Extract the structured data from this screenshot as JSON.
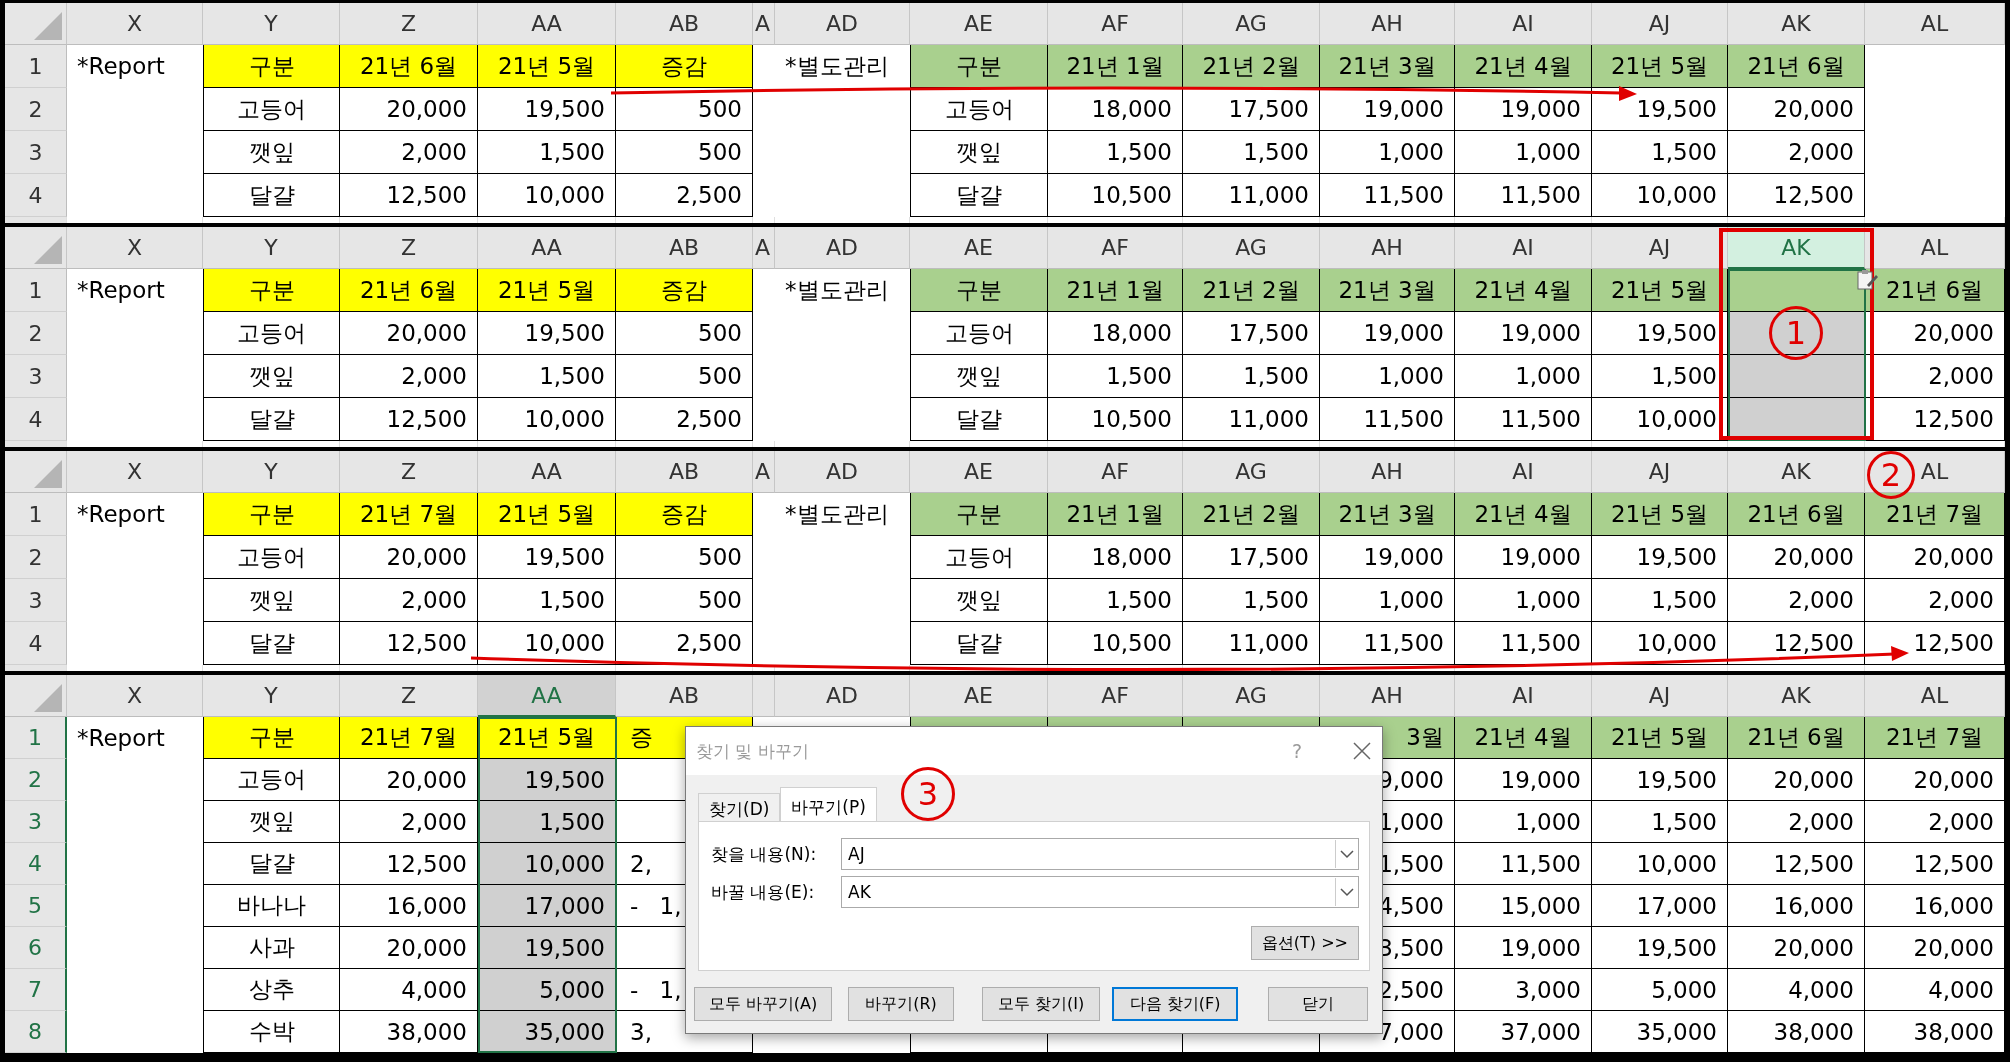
{
  "panels": [
    {
      "columns": [
        {
          "label": "X",
          "kind": "plain",
          "selected": false
        },
        {
          "label": "Y",
          "kind": "report-label",
          "selected": false
        },
        {
          "label": "Z",
          "kind": "report",
          "selected": false
        },
        {
          "label": "AA",
          "kind": "report",
          "selected": false
        },
        {
          "label": "AB",
          "kind": "report",
          "selected": false
        },
        {
          "label": "A",
          "kind": "plain",
          "selected": false
        },
        {
          "label": "AD",
          "kind": "plain",
          "selected": false
        },
        {
          "label": "AE",
          "kind": "record-label",
          "selected": false
        },
        {
          "label": "AF",
          "kind": "record",
          "selected": false
        },
        {
          "label": "AG",
          "kind": "record",
          "selected": false
        },
        {
          "label": "AH",
          "kind": "record",
          "selected": false
        },
        {
          "label": "AI",
          "kind": "record",
          "selected": false
        },
        {
          "label": "AJ",
          "kind": "record",
          "selected": false
        },
        {
          "label": "AK",
          "kind": "record",
          "selected": false
        },
        {
          "label": "AL",
          "kind": "plain",
          "selected": false
        }
      ],
      "rows": [
        {
          "number": "1",
          "selected": false,
          "cells": [
            "*Report",
            "구분",
            "21년 6월",
            "21년 5월",
            "증감",
            null,
            "*별도관리",
            "구분",
            "21년 1월",
            "21년 2월",
            "21년 3월",
            "21년 4월",
            "21년 5월",
            "21년 6월",
            null
          ]
        },
        {
          "number": "2",
          "selected": false,
          "cells": [
            null,
            "고등어",
            "20,000",
            "19,500",
            "500",
            null,
            null,
            "고등어",
            "18,000",
            "17,500",
            "19,000",
            "19,000",
            "19,500",
            "20,000",
            null
          ]
        },
        {
          "number": "3",
          "selected": false,
          "cells": [
            null,
            "깻잎",
            "2,000",
            "1,500",
            "500",
            null,
            null,
            "깻잎",
            "1,500",
            "1,500",
            "1,000",
            "1,000",
            "1,500",
            "2,000",
            null
          ]
        },
        {
          "number": "4",
          "selected": false,
          "cells": [
            null,
            "달걀",
            "12,500",
            "10,000",
            "2,500",
            null,
            null,
            "달걀",
            "10,500",
            "11,000",
            "11,500",
            "11,500",
            "10,000",
            "12,500",
            null
          ]
        }
      ]
    },
    {
      "columns": [
        {
          "label": "X",
          "kind": "plain",
          "selected": false
        },
        {
          "label": "Y",
          "kind": "report-label",
          "selected": false
        },
        {
          "label": "Z",
          "kind": "report",
          "selected": false
        },
        {
          "label": "AA",
          "kind": "report",
          "selected": false
        },
        {
          "label": "AB",
          "kind": "report",
          "selected": false
        },
        {
          "label": "A",
          "kind": "plain",
          "selected": false
        },
        {
          "label": "AD",
          "kind": "plain",
          "selected": false
        },
        {
          "label": "AE",
          "kind": "record-label",
          "selected": false
        },
        {
          "label": "AF",
          "kind": "record",
          "selected": false
        },
        {
          "label": "AG",
          "kind": "record",
          "selected": false
        },
        {
          "label": "AH",
          "kind": "record",
          "selected": false
        },
        {
          "label": "AI",
          "kind": "record",
          "selected": false
        },
        {
          "label": "AJ",
          "kind": "record",
          "selected": false
        },
        {
          "label": "AK",
          "kind": "record",
          "selected": true
        },
        {
          "label": "AL",
          "kind": "record",
          "selected": false
        }
      ],
      "callout": "1",
      "rows": [
        {
          "number": "1",
          "selected": false,
          "cells": [
            "*Report",
            "구분",
            "21년 6월",
            "21년 5월",
            "증감",
            null,
            "*별도관리",
            "구분",
            "21년 1월",
            "21년 2월",
            "21년 3월",
            "21년 4월",
            "21년 5월",
            null,
            "21년 6월"
          ]
        },
        {
          "number": "2",
          "selected": false,
          "cells": [
            null,
            "고등어",
            "20,000",
            "19,500",
            "500",
            null,
            null,
            "고등어",
            "18,000",
            "17,500",
            "19,000",
            "19,000",
            "19,500",
            null,
            "20,000"
          ]
        },
        {
          "number": "3",
          "selected": false,
          "cells": [
            null,
            "깻잎",
            "2,000",
            "1,500",
            "500",
            null,
            null,
            "깻잎",
            "1,500",
            "1,500",
            "1,000",
            "1,000",
            "1,500",
            null,
            "2,000"
          ]
        },
        {
          "number": "4",
          "selected": false,
          "cells": [
            null,
            "달걀",
            "12,500",
            "10,000",
            "2,500",
            null,
            null,
            "달걀",
            "10,500",
            "11,000",
            "11,500",
            "11,500",
            "10,000",
            null,
            "12,500"
          ]
        }
      ]
    },
    {
      "columns": [
        {
          "label": "X",
          "kind": "plain",
          "selected": false
        },
        {
          "label": "Y",
          "kind": "report-label",
          "selected": false
        },
        {
          "label": "Z",
          "kind": "report",
          "selected": false
        },
        {
          "label": "AA",
          "kind": "report",
          "selected": false
        },
        {
          "label": "AB",
          "kind": "report",
          "selected": false
        },
        {
          "label": "A",
          "kind": "plain",
          "selected": false
        },
        {
          "label": "AD",
          "kind": "plain",
          "selected": false
        },
        {
          "label": "AE",
          "kind": "record-label",
          "selected": false
        },
        {
          "label": "AF",
          "kind": "record",
          "selected": false
        },
        {
          "label": "AG",
          "kind": "record",
          "selected": false
        },
        {
          "label": "AH",
          "kind": "record",
          "selected": false
        },
        {
          "label": "AI",
          "kind": "record",
          "selected": false
        },
        {
          "label": "AJ",
          "kind": "record",
          "selected": false
        },
        {
          "label": "AK",
          "kind": "record",
          "selected": false
        },
        {
          "label": "AL",
          "kind": "record",
          "selected": false
        }
      ],
      "callout": "2",
      "rows": [
        {
          "number": "1",
          "selected": false,
          "cells": [
            "*Report",
            "구분",
            "21년 7월",
            "21년 5월",
            "증감",
            null,
            "*별도관리",
            "구분",
            "21년 1월",
            "21년 2월",
            "21년 3월",
            "21년 4월",
            "21년 5월",
            "21년 6월",
            "21년 7월"
          ]
        },
        {
          "number": "2",
          "selected": false,
          "cells": [
            null,
            "고등어",
            "20,000",
            "19,500",
            "500",
            null,
            null,
            "고등어",
            "18,000",
            "17,500",
            "19,000",
            "19,000",
            "19,500",
            "20,000",
            "20,000"
          ]
        },
        {
          "number": "3",
          "selected": false,
          "cells": [
            null,
            "깻잎",
            "2,000",
            "1,500",
            "500",
            null,
            null,
            "깻잎",
            "1,500",
            "1,500",
            "1,000",
            "1,000",
            "1,500",
            "2,000",
            "2,000"
          ]
        },
        {
          "number": "4",
          "selected": false,
          "cells": [
            null,
            "달걀",
            "12,500",
            "10,000",
            "2,500",
            null,
            null,
            "달걀",
            "10,500",
            "11,000",
            "11,500",
            "11,500",
            "10,000",
            "12,500",
            "12,500"
          ]
        }
      ]
    },
    {
      "columns": [
        {
          "label": "X",
          "kind": "plain",
          "selected": false
        },
        {
          "label": "Y",
          "kind": "report-label",
          "selected": false
        },
        {
          "label": "Z",
          "kind": "report",
          "selected": false
        },
        {
          "label": "AA",
          "kind": "report",
          "selected": true
        },
        {
          "label": "AB",
          "kind": "report",
          "selected": false
        },
        {
          "kind": "plain",
          "selected": false
        },
        {
          "label": "AD",
          "kind": "plain",
          "selected": false
        },
        {
          "label": "AE",
          "kind": "record-label",
          "selected": false
        },
        {
          "label": "AF",
          "kind": "record",
          "selected": false
        },
        {
          "label": "AG",
          "kind": "record",
          "selected": false
        },
        {
          "label": "AH",
          "kind": "record",
          "selected": false
        },
        {
          "label": "AI",
          "kind": "record",
          "selected": false
        },
        {
          "label": "AJ",
          "kind": "record",
          "selected": false
        },
        {
          "label": "AK",
          "kind": "record",
          "selected": false
        },
        {
          "label": "AL",
          "kind": "record",
          "selected": false
        }
      ],
      "rows": [
        {
          "number": "1",
          "selected": true,
          "cells": [
            "*Report",
            "구분",
            "21년 7월",
            "21년 5월",
            "증",
            null,
            null,
            null,
            null,
            null,
            "3월",
            "21년 4월",
            "21년 5월",
            "21년 6월",
            "21년 7월"
          ]
        },
        {
          "number": "2",
          "selected": true,
          "cells": [
            null,
            "고등어",
            "20,000",
            "19,500",
            null,
            null,
            null,
            null,
            null,
            null,
            "9,000",
            "19,000",
            "19,500",
            "20,000",
            "20,000"
          ]
        },
        {
          "number": "3",
          "selected": true,
          "cells": [
            null,
            "깻잎",
            "2,000",
            "1,500",
            null,
            null,
            null,
            null,
            null,
            null,
            "1,000",
            "1,000",
            "1,500",
            "2,000",
            "2,000"
          ]
        },
        {
          "number": "4",
          "selected": true,
          "cells": [
            null,
            "달걀",
            "12,500",
            "10,000",
            "2,",
            null,
            null,
            null,
            null,
            null,
            "1,500",
            "11,500",
            "10,000",
            "12,500",
            "12,500"
          ]
        },
        {
          "number": "5",
          "selected": true,
          "cells": [
            null,
            "바나나",
            "16,000",
            "17,000",
            "- 1,",
            null,
            null,
            null,
            null,
            null,
            "4,500",
            "15,000",
            "17,000",
            "16,000",
            "16,000"
          ]
        },
        {
          "number": "6",
          "selected": true,
          "cells": [
            null,
            "사과",
            "20,000",
            "19,500",
            null,
            null,
            null,
            null,
            null,
            null,
            "3,500",
            "19,000",
            "19,500",
            "20,000",
            "20,000"
          ]
        },
        {
          "number": "7",
          "selected": true,
          "cells": [
            null,
            "상추",
            "4,000",
            "5,000",
            "- 1,",
            null,
            null,
            null,
            null,
            null,
            "2,500",
            "3,000",
            "5,000",
            "4,000",
            "4,000"
          ]
        },
        {
          "number": "8",
          "selected": true,
          "cells": [
            null,
            "수박",
            "38,000",
            "35,000",
            "3,",
            null,
            null,
            null,
            null,
            null,
            "7,000",
            "37,000",
            "35,000",
            "38,000",
            "38,000"
          ]
        }
      ],
      "dialog": {
        "title": "찾기 및 바꾸기",
        "help": "?",
        "callout": "3",
        "tabs": [
          {
            "label": "찾기(D)",
            "selected": false
          },
          {
            "label": "바꾸기(P)",
            "selected": true
          }
        ],
        "fields": [
          {
            "label": "찾을 내용(N):",
            "value": "AJ"
          },
          {
            "label": "바꿀 내용(E):",
            "value": "AK"
          }
        ],
        "options_button": "옵션(T) >>",
        "buttons": [
          {
            "label": "모두 바꾸기(A)",
            "default": false
          },
          {
            "label": "바꾸기(R)",
            "default": false
          },
          {
            "label": "모두 찾기(I)",
            "default": false
          },
          {
            "label": "다음 찾기(F)",
            "default": true
          },
          {
            "label": "닫기",
            "default": false
          }
        ]
      }
    }
  ]
}
